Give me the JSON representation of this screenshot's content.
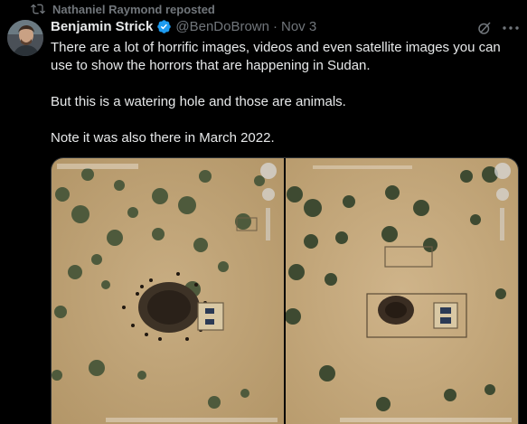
{
  "repost": {
    "label": "Nathaniel Raymond reposted",
    "icon": "repost-icon"
  },
  "author": {
    "name": "Benjamin Strick",
    "handle": "@BenDoBrown",
    "separator": "·",
    "date": "Nov 3",
    "verified": true,
    "verified_color": "#1d9bf0"
  },
  "tweet": {
    "paragraphs": [
      "There are a lot of horrific images, videos and even satellite images you can use to show the horrors that are happening in Sudan.",
      "But this is a watering hole and those are animals.",
      "Note it was also there in March 2022."
    ]
  },
  "media": {
    "images": [
      {
        "description_name": "satellite-image-with-animals",
        "icon": "image"
      },
      {
        "description_name": "satellite-image-march-2022",
        "icon": "image"
      }
    ]
  },
  "colors": {
    "background": "#000000",
    "text_primary": "#e7e9ea",
    "text_secondary": "#71767b",
    "accent": "#1d9bf0"
  },
  "icons": {
    "grok": "grok-icon",
    "more": "more-icon"
  }
}
